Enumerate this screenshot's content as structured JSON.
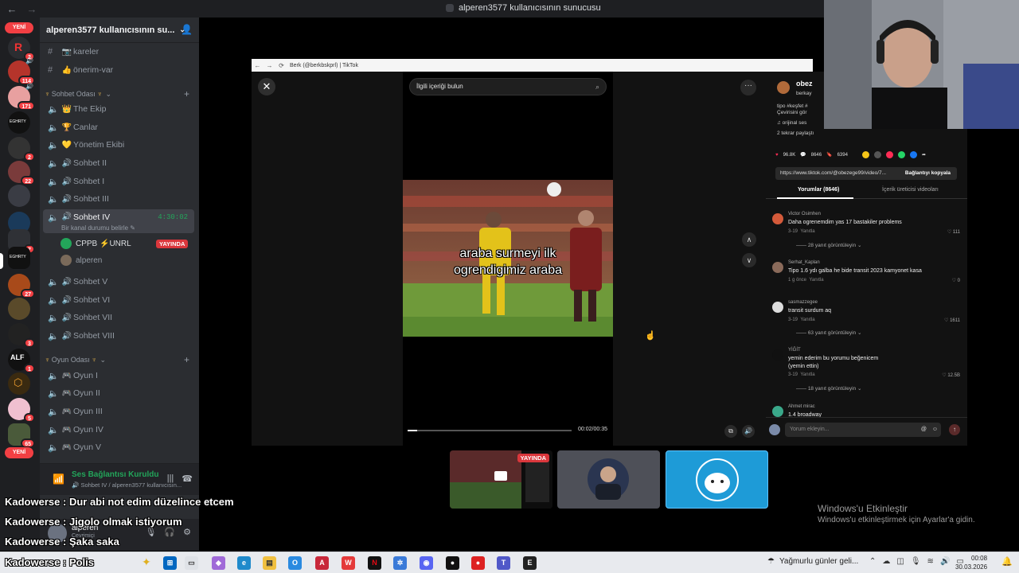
{
  "window": {
    "title": "alperen3577 kullanıcısının sunucusu"
  },
  "rail": {
    "new_label": "YENİ",
    "badges": [
      "2",
      "114",
      "171",
      "2",
      "22",
      "7",
      "27",
      "3",
      "1",
      "5",
      "65"
    ],
    "new_label_bottom": "YENİ"
  },
  "server": {
    "name": "alperen3577 kullanıcısının su...",
    "text_channels": [
      {
        "emoji": "📷",
        "name": "kareler"
      },
      {
        "emoji": "👍",
        "name": "önerim-var"
      }
    ],
    "category_chat": "Sohbet Odası",
    "voice_channels_top": [
      {
        "emoji": "👑",
        "name": "The Ekip"
      },
      {
        "emoji": "🏆",
        "name": "Canlar"
      },
      {
        "emoji": "💛",
        "name": "Yönetim Ekibi"
      },
      {
        "emoji": "🔊",
        "name": "Sohbet II"
      },
      {
        "emoji": "🔊",
        "name": "Sohbet I"
      },
      {
        "emoji": "🔊",
        "name": "Sohbet III"
      }
    ],
    "active_channel": {
      "emoji": "🔊",
      "name": "Sohbet IV",
      "time": "4:30:02",
      "status": "Bir kanal durumu belirle"
    },
    "voice_users": [
      {
        "name": "CPPB ⚡UNRL",
        "live": "YAYINDA"
      },
      {
        "name": "alperen"
      }
    ],
    "voice_channels_bottom": [
      {
        "emoji": "🔊",
        "name": "Sohbet V"
      },
      {
        "emoji": "🔊",
        "name": "Sohbet VI"
      },
      {
        "emoji": "🔊",
        "name": "Sohbet VII"
      },
      {
        "emoji": "🔊",
        "name": "Sohbet VIII"
      }
    ],
    "category_games": "Oyun Odası",
    "game_channels": [
      {
        "emoji": "🎮",
        "name": "Oyun I"
      },
      {
        "emoji": "🎮",
        "name": "Oyun II"
      },
      {
        "emoji": "🎮",
        "name": "Oyun III"
      },
      {
        "emoji": "🎮",
        "name": "Oyun IV"
      },
      {
        "emoji": "🎮",
        "name": "Oyun V"
      }
    ]
  },
  "voice_panel": {
    "status": "Ses Bağlantısı Kuruldu",
    "sub": "Sohbet IV / alperen3577 kullanıcısın..."
  },
  "user_panel": {
    "name": "alperen",
    "status": "Çevrimiçi"
  },
  "browser": {
    "tab_title": "Berk (@berkbskprl) | TikTok"
  },
  "tiktok": {
    "search_placeholder": "İlgili içeriği bulun",
    "caption_line1": "araba surmeyi ilk",
    "caption_line2": "ogrendigimiz araba",
    "time": "00:02/00:35",
    "progress": 0.06,
    "author": "obez",
    "author_handle": "berkay",
    "desc": "tipo #keşfet #",
    "desc2": "Çevirisini gör",
    "sound": "♫ orijinal ses",
    "shares": "2 tekrar paylaştı",
    "likes": "96.8K",
    "comments_count": "8646",
    "saves": "6394",
    "link": "https://www.tiktok.com/@obezege99/video/7...",
    "copy_link": "Bağlantıyı kopyala",
    "tab_comments": "Yorumlar (8646)",
    "tab_creator": "İçerik üreticisi videoları",
    "comments": [
      {
        "user": "Victor Osimhen",
        "text": "Daha ogrenemdim yas 17 bastakiler problems",
        "date": "3-19",
        "reply": "Yanıtla",
        "likes": "111",
        "more": "28 yanıt görüntüleyin"
      },
      {
        "user": "Serhat_Kaplan",
        "text": "Tipo 1.6 ydı galba he bide transit 2023 kamyonet kasa",
        "date": "1 g önce",
        "reply": "Yanıtla",
        "likes": "0"
      },
      {
        "user": "sasmazzegee",
        "text": "transit surdum aq",
        "date": "3-19",
        "reply": "Yanıtla",
        "likes": "1611",
        "more": "63 yanıt görüntüleyin"
      },
      {
        "user": "YİĞİT",
        "text": "yemin ederim bu yorumu beğenicem",
        "text2": "(yemin ettin)",
        "date": "3-19",
        "reply": "Yanıtla",
        "likes": "12.5B",
        "more": "18 yanıt görüntüleyin"
      },
      {
        "user": "Ahmet mirac",
        "text": "1.4 broadway"
      }
    ],
    "add_comment": "Yorum ekleyin..."
  },
  "tiles": {
    "live_label": "YAYINDA"
  },
  "chat_overlay": [
    {
      "user": "Kadowerse",
      "msg": "Dur abi not edim düzelince etcem"
    },
    {
      "user": "Kadowerse",
      "msg": "Jigolo olmak istiyorum"
    },
    {
      "user": "Kadowerse",
      "msg": "Şaka saka"
    },
    {
      "user": "Kadowerse",
      "msg": "Polis"
    }
  ],
  "activation": {
    "title": "Windows'u Etkinleştir",
    "sub": "Windows'u etkinleştirmek için Ayarlar'a gidin."
  },
  "taskbar": {
    "weather": "Yağmurlu günler geli...",
    "time": "00:08",
    "date": "30.03.2026"
  }
}
